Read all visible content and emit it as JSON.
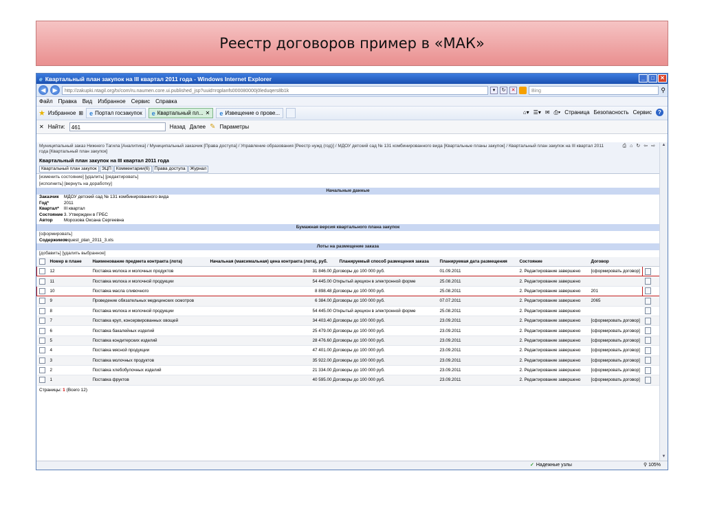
{
  "slide": {
    "title": "Реестр договоров пример в «МАК»"
  },
  "browser": {
    "title": "Квартальный план закупок на III квартал 2011 года - Windows Internet Explorer",
    "address": "http://zakupki.ntagil.org/tx/com/ru.naumen.core.ui.published_jsp?uuid=rqplanfs000080000j0leduqers8b1k",
    "search_placeholder": "Bing",
    "menu": [
      "Файл",
      "Правка",
      "Вид",
      "Избранное",
      "Сервис",
      "Справка"
    ],
    "favorites_label": "Избранное",
    "tabs": [
      "Портал госзакупок",
      "Квартальный пл...",
      "Извещение о прове..."
    ],
    "toolbar_right": [
      "Страница",
      "Безопасность",
      "Сервис"
    ],
    "find": {
      "label": "Найти:",
      "value": "461",
      "back": "Назад",
      "forward": "Далее",
      "params": "Параметры"
    },
    "status": {
      "zone": "Надежные узлы",
      "zoom": "105%"
    }
  },
  "page": {
    "breadcrumb": "Муниципальный заказ Нижнего Тагила [Аналитика] / Муниципальный заказчик [Права доступа] / Управление образования [Реестр нужд (год)] / МДОУ детский сад № 131 комбинированного вида [Квартальные планы закупок] / Квартальный план закупок на III квартал 2011 года [Квартальный план закупок]",
    "heading": "Квартальный план закупок на III квартал 2011 года",
    "subtabs": [
      "Квартальный план закупок",
      "ЭЦП",
      "Комментарии(6)",
      "Права доступа",
      "Журнал"
    ],
    "actions1": "[изменить состояние] [удалить] [редактировать]",
    "actions2": "[исполнить] [вернуть на доработку]",
    "section_initial": "Начальные данные",
    "fields": [
      {
        "label": "Заказчик",
        "value": "МДОУ детский сад № 131 комбинированного вида"
      },
      {
        "label": "Год*",
        "value": "2011"
      },
      {
        "label": "Квартал*",
        "value": "III квартал"
      },
      {
        "label": "Состояние",
        "value": "3. Утвержден в ГРБС"
      },
      {
        "label": "Автор",
        "value": "Морозова Оксана Сергеевна"
      }
    ],
    "section_paper": "Бумажная версия квартального плана закупок",
    "form_link": "[сформировать]",
    "content_label": "Содержимое",
    "content_value": "request_plan_2011_3.xls",
    "section_lots": "Лоты на размещение заказа",
    "lots_actions": "[добавить] [удалить выбранное]",
    "columns": [
      "Номер в плане",
      "Наименование предмета контракта (лота)",
      "Начальная (максимальная) цена контракта (лота), руб.",
      "Планируемый способ размещения заказа",
      "Планируемая дата размещения",
      "Состояние",
      "Договор"
    ],
    "rows": [
      {
        "num": "12",
        "name": "Поставка молока и молочных продуктов",
        "price": "31 846.00",
        "method": "Договоры до 100 000 руб.",
        "date": "01.09.2011",
        "state": "2. Редактирование завершено",
        "contract": "[сформировать договор]"
      },
      {
        "num": "11",
        "name": "Поставка молока и молочной продукции",
        "price": "54 445.00",
        "method": "Открытый аукцион в электронной форме",
        "date": "25.08.2011",
        "state": "2. Редактирование завершено",
        "contract": ""
      },
      {
        "num": "10",
        "name": "Поставка масла сливочного",
        "price": "8 898.48",
        "method": "Договоры до 100 000 руб.",
        "date": "25.08.2011",
        "state": "2. Редактирование завершено",
        "contract": "201"
      },
      {
        "num": "9",
        "name": "Проведение обязательных медицинских осмотров",
        "price": "6 384.00",
        "method": "Договоры до 100 000 руб.",
        "date": "07.07.2011",
        "state": "2. Редактирование завершено",
        "contract": "2065"
      },
      {
        "num": "8",
        "name": "Поставка молока и молочной продукции",
        "price": "54 445.00",
        "method": "Открытый аукцион в электронной форме",
        "date": "25.08.2011",
        "state": "2. Редактирование завершено",
        "contract": ""
      },
      {
        "num": "7",
        "name": "Поставка круп, консервированных овощей",
        "price": "34 403.40",
        "method": "Договоры до 100 000 руб.",
        "date": "23.09.2011",
        "state": "2. Редактирование завершено",
        "contract": "[сформировать договор]"
      },
      {
        "num": "6",
        "name": "Поставка бакалейных изделий",
        "price": "25 479.00",
        "method": "Договоры до 100 000 руб.",
        "date": "23.09.2011",
        "state": "2. Редактирование завершено",
        "contract": "[сформировать договор]"
      },
      {
        "num": "5",
        "name": "Поставка кондитерских изделий",
        "price": "28 476.60",
        "method": "Договоры до 100 000 руб.",
        "date": "23.09.2011",
        "state": "2. Редактирование завершено",
        "contract": "[сформировать договор]"
      },
      {
        "num": "4",
        "name": "Поставка мясной продукции",
        "price": "47 401.00",
        "method": "Договоры до 100 000 руб.",
        "date": "23.09.2011",
        "state": "2. Редактирование завершено",
        "contract": "[сформировать договор]"
      },
      {
        "num": "3",
        "name": "Поставка молочных продуктов",
        "price": "35 922.00",
        "method": "Договоры до 100 000 руб.",
        "date": "23.09.2011",
        "state": "2. Редактирование завершено",
        "contract": "[сформировать договор]"
      },
      {
        "num": "2",
        "name": "Поставка хлебобулочных изделий",
        "price": "21 334.00",
        "method": "Договоры до 100 000 руб.",
        "date": "23.09.2011",
        "state": "2. Редактирование завершено",
        "contract": "[сформировать договор]"
      },
      {
        "num": "1",
        "name": "Поставка фруктов",
        "price": "40 595.00",
        "method": "Договоры до 100 000 руб.",
        "date": "23.09.2011",
        "state": "2. Редактирование завершено",
        "contract": "[сформировать договор]"
      }
    ],
    "highlighted_rows": [
      "12",
      "10"
    ],
    "pages_label": "Страницы:",
    "pages_current": "1",
    "pages_total": "(Всего 12)"
  }
}
